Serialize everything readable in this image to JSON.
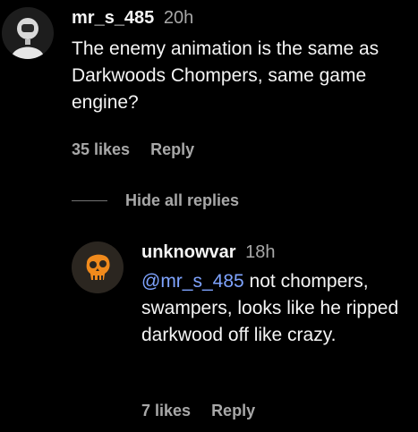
{
  "comments": [
    {
      "username": "mr_s_485",
      "timestamp": "20h",
      "text": "The enemy animation is the same as Darkwoods Chompers, same game engine?",
      "likes": "35 likes",
      "reply_label": "Reply"
    }
  ],
  "replies_toggle": {
    "label": "Hide all replies"
  },
  "replies": [
    {
      "username": "unknowvar",
      "timestamp": "18h",
      "mention": "@mr_s_485",
      "text": " not chompers, swampers, looks like he ripped darkwood off like crazy.",
      "likes": "7 likes",
      "reply_label": "Reply"
    }
  ],
  "colors": {
    "background": "#000000",
    "text": "#f5f5f5",
    "secondary": "#a8a8a8",
    "mention": "#7fa4ff"
  },
  "icons": {
    "avatar_1": "astronaut-avatar-icon",
    "avatar_2": "orange-skull-avatar-icon"
  }
}
